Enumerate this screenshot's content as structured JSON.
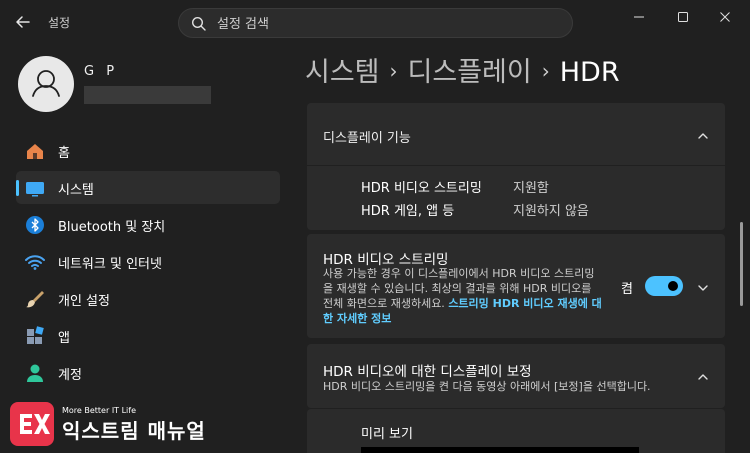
{
  "app": {
    "title": "설정"
  },
  "search": {
    "placeholder": "설정 검색"
  },
  "profile": {
    "name": "G P"
  },
  "sidebar": {
    "items": [
      {
        "label": "홈",
        "icon": "home-icon",
        "active": false
      },
      {
        "label": "시스템",
        "icon": "system-display-icon",
        "active": true
      },
      {
        "label": "Bluetooth 및 장치",
        "icon": "bluetooth-icon",
        "active": false
      },
      {
        "label": "네트워크 및 인터넷",
        "icon": "wifi-icon",
        "active": false
      },
      {
        "label": "개인 설정",
        "icon": "paintbrush-icon",
        "active": false
      },
      {
        "label": "앱",
        "icon": "apps-icon",
        "active": false
      },
      {
        "label": "계정",
        "icon": "account-icon",
        "active": false
      }
    ]
  },
  "breadcrumb": {
    "level1": "시스템",
    "level2": "디스플레이",
    "current": "HDR"
  },
  "display_capabilities": {
    "title": "디스플레이 기능",
    "rows": [
      {
        "label": "HDR 비디오 스트리밍",
        "value": "지원함"
      },
      {
        "label": "HDR 게임, 앱 등",
        "value": "지원하지 않음"
      }
    ]
  },
  "hdr_streaming": {
    "title": "HDR 비디오 스트리밍",
    "description": "사용 가능한 경우 이 디스플레이에서 HDR 비디오 스트리밍을 재생할 수 있습니다. 최상의 결과를 위해 HDR 비디오를 전체 화면으로 재생하세요. ",
    "link": "스트리밍 HDR 비디오 재생에 대한 자세한 정보",
    "toggle_label": "켬",
    "toggle_on": true
  },
  "calibration": {
    "title": "HDR 비디오에 대한 디스플레이 보정",
    "description": "HDR 비디오 스트리밍을 켠 다음 동영상 아래에서 [보정]을 선택합니다.",
    "preview_label": "미리 보기"
  },
  "watermark": {
    "tagline": "More Better IT Life",
    "brand": "익스트림 매뉴얼",
    "badge": "EX"
  },
  "colors": {
    "accent": "#4cc2ff",
    "background": "#202020",
    "card": "#2b2b2b",
    "link": "#60cdff",
    "watermark": "#e8344a"
  }
}
